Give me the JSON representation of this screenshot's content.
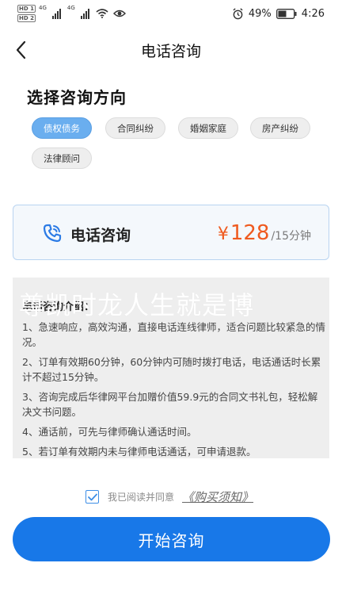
{
  "status_bar": {
    "hd1": "HD 1",
    "hd2": "HD 2",
    "network1": "4G",
    "network2": "4G",
    "battery": "49%",
    "time": "4:26"
  },
  "nav": {
    "title": "电话咨询",
    "back_icon": "chevron-left-icon"
  },
  "categories": {
    "title": "选择咨询方向",
    "items": [
      {
        "label": "债权债务",
        "active": true
      },
      {
        "label": "合同纠纷",
        "active": false
      },
      {
        "label": "婚姻家庭",
        "active": false
      },
      {
        "label": "房产纠纷",
        "active": false
      },
      {
        "label": "法律顾问",
        "active": false
      }
    ]
  },
  "service": {
    "icon": "phone-call-icon",
    "name": "电话咨询",
    "currency": "¥",
    "price": "128",
    "unit": "/15分钟"
  },
  "intro": {
    "watermark": "尊凯时龙人生就是博",
    "heading": "电话咨询介绍：",
    "items": [
      "1、急速响应，高效沟通，直接电话连线律师，适合问题比较紧急的情况。",
      "2、订单有效期60分钟，60分钟内可随时拨打电话，电话通话时长累计不超过15分钟。",
      "3、咨询完成后华律网平台加赠价值59.9元的合同文书礼包，轻松解决文书问题。",
      "4、通话前，可先与律师确认通话时间。",
      "5、若订单有效期内未与律师电话通话，可申请退款。"
    ]
  },
  "agreement": {
    "checked": true,
    "text": "我已阅读并同意",
    "link": "《购买须知》"
  },
  "actions": {
    "start_label": "开始咨询"
  },
  "colors": {
    "primary": "#1878e8",
    "chip_active": "#6aaeef",
    "price": "#ef5a1f"
  }
}
